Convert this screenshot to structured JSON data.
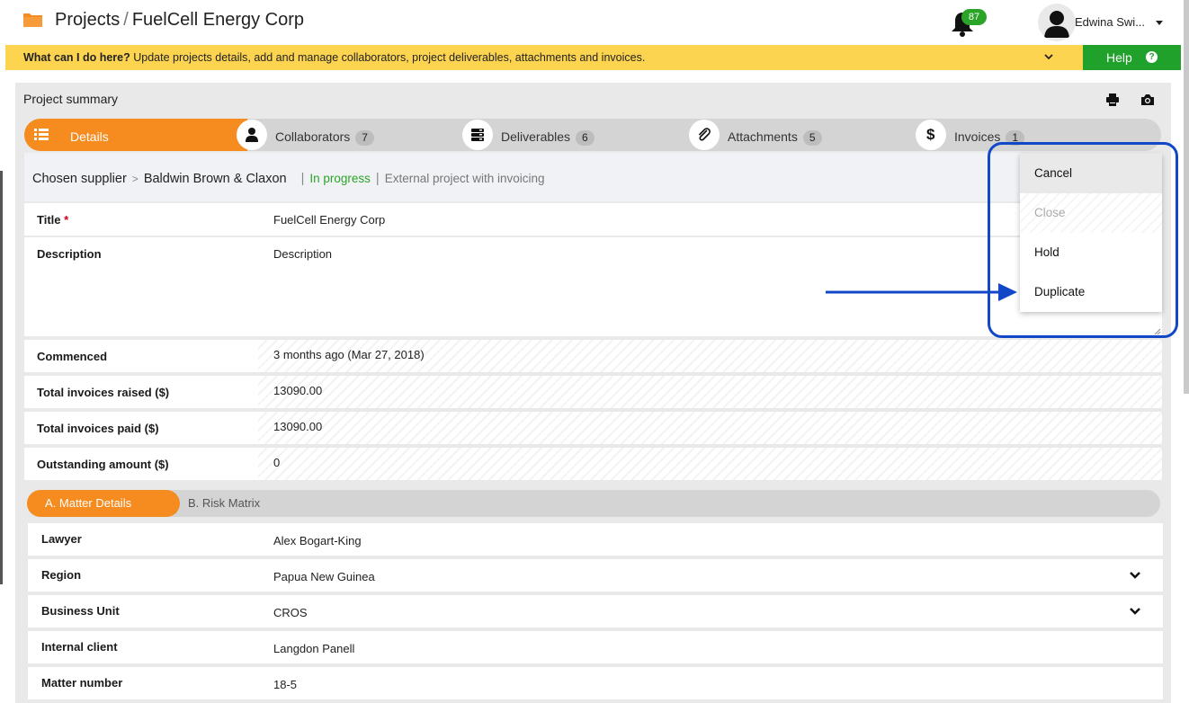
{
  "header": {
    "crumb_root": "Projects",
    "crumb_separator": "/",
    "crumb_current": "FuelCell Energy Corp",
    "notifications_count": "87",
    "user_name": "Edwina Swi..."
  },
  "helpbar": {
    "question": "What can I do here?",
    "text": " Update projects details, add and manage collaborators, project deliverables, attachments and invoices.",
    "help_label": "Help",
    "help_icon_glyph": "?"
  },
  "panel": {
    "title": "Project summary"
  },
  "tabs": [
    {
      "label": "Details",
      "count": ""
    },
    {
      "label": "Collaborators",
      "count": "7"
    },
    {
      "label": "Deliverables",
      "count": "6"
    },
    {
      "label": "Attachments",
      "count": "5"
    },
    {
      "label": "Invoices",
      "count": "1"
    }
  ],
  "supplier": {
    "label": "Chosen supplier",
    "arrow": ">",
    "name": "Baldwin Brown & Claxon",
    "bar": "|",
    "status": "In progress",
    "type": "External project with invoicing"
  },
  "fields": {
    "title_label": "Title",
    "title_required_mark": "*",
    "title_value": "FuelCell Energy Corp",
    "description_label": "Description",
    "description_placeholder": "Description",
    "commenced_label": "Commenced",
    "commenced_value": "3 months ago (Mar 27, 2018)",
    "raised_label": "Total invoices raised ($)",
    "raised_value": "13090.00",
    "paid_label": "Total invoices paid ($)",
    "paid_value": "13090.00",
    "outstanding_label": "Outstanding amount ($)",
    "outstanding_value": "0"
  },
  "subtabs": {
    "active": "A. Matter Details",
    "other": "B. Risk Matrix"
  },
  "matter": {
    "lawyer_label": "Lawyer",
    "lawyer_value": "Alex Bogart-King",
    "region_label": "Region",
    "region_value": "Papua New Guinea",
    "bu_label": "Business Unit",
    "bu_value": "CROS",
    "client_label": "Internal client",
    "client_value": "Langdon Panell",
    "number_label": "Matter number",
    "number_value": "18-5"
  },
  "dropdown": {
    "items": [
      "Cancel",
      "Close",
      "Hold",
      "Duplicate"
    ]
  },
  "colors": {
    "accent": "#f68b1f",
    "help_bar": "#fdd450",
    "help_button": "#1fa12b",
    "status_green": "#2aa527",
    "callout_blue": "#1248c7"
  },
  "icons": [
    "folder-icon",
    "bell-icon",
    "user-icon",
    "chevron-down-icon",
    "help-icon",
    "print-icon",
    "camera-icon",
    "list-icon",
    "person-icon",
    "stack-icon",
    "paperclip-icon",
    "dollar-icon"
  ]
}
